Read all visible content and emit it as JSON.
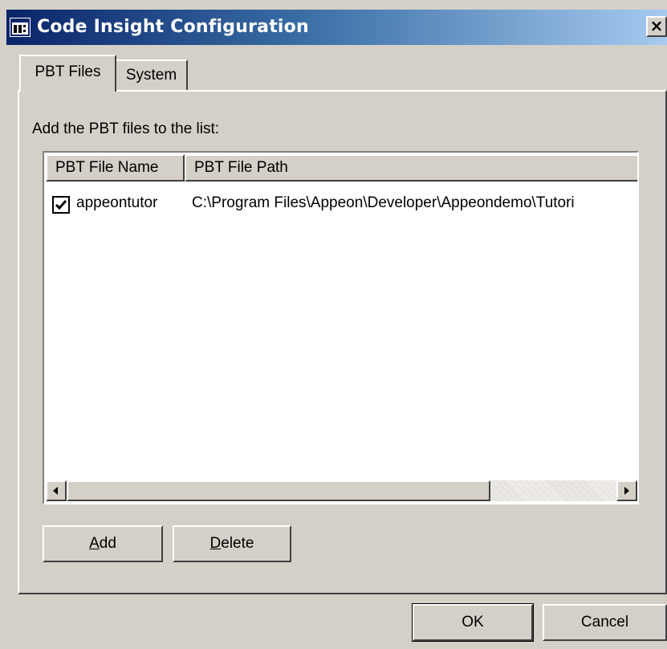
{
  "window": {
    "title": "Code Insight Configuration",
    "close_glyph": "×"
  },
  "tabs": [
    {
      "label": "PBT Files",
      "active": true
    },
    {
      "label": "System",
      "active": false
    }
  ],
  "instruction": "Add the PBT files to the list:",
  "list": {
    "columns": [
      "PBT File Name",
      "PBT File Path"
    ],
    "rows": [
      {
        "checked": true,
        "name": "appeontutor",
        "path": "C:\\Program Files\\Appeon\\Developer\\Appeondemo\\Tutori"
      }
    ]
  },
  "buttons": {
    "add": {
      "mnemonic": "A",
      "rest": "dd"
    },
    "delete": {
      "mnemonic": "D",
      "rest": "elete"
    },
    "ok": "OK",
    "cancel": "Cancel"
  },
  "icons": {
    "window_icon": "app-window-icon",
    "scroll_left": "left-arrow-icon",
    "scroll_right": "right-arrow-icon",
    "check": "checkmark-icon"
  }
}
